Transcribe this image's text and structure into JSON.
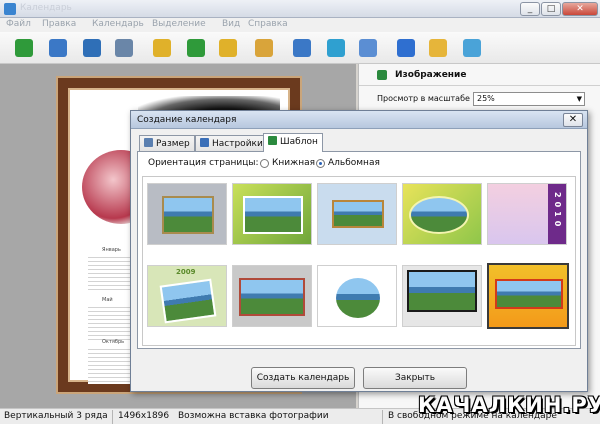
{
  "window": {
    "title": "Календарь",
    "controls": [
      "_",
      "□",
      "✕"
    ]
  },
  "menu": [
    "Файл",
    "Правка",
    "Календарь",
    "Выделение",
    "Вид",
    "Справка"
  ],
  "toolbar": [
    {
      "icon": "add-page-icon",
      "color": "#2f9a3a"
    },
    {
      "icon": "image-lbp-icon",
      "color": "#3b78c6"
    },
    {
      "icon": "save-icon",
      "color": "#2f6fb7"
    },
    {
      "icon": "print-icon",
      "color": "#6a86a8"
    },
    {
      "icon": "add-folder-icon",
      "color": "#e0b12a"
    },
    {
      "icon": "text-icon",
      "color": "#2f9a3a"
    },
    {
      "icon": "edit-text-icon",
      "color": "#e0b12a"
    },
    {
      "icon": "picture-icon",
      "color": "#d9a43a"
    },
    {
      "icon": "grid-icon",
      "color": "#3b78c6"
    },
    {
      "icon": "move-icon",
      "color": "#2fa0d0"
    },
    {
      "icon": "zoom-icon",
      "color": "#5b8ed3"
    },
    {
      "icon": "help-icon",
      "color": "#2f6fd0"
    },
    {
      "icon": "lock-icon",
      "color": "#e6b53a"
    },
    {
      "icon": "box-icon",
      "color": "#4aa3d8"
    }
  ],
  "panel": {
    "title": "Изображение",
    "zoom_label": "Просмотр в масштабе",
    "zoom_value": "25%"
  },
  "preview": {
    "months": [
      "Январь",
      "Май",
      "Октябрь"
    ]
  },
  "dialog": {
    "title": "Создание календаря",
    "close": "✕",
    "tabs": [
      "Размер",
      "Настройки",
      "Шаблон"
    ],
    "orientation_label": "Ориентация страницы:",
    "orientation_options": [
      "Книжная",
      "Альбомная"
    ],
    "orientation_selected": "Альбомная",
    "template_years": {
      "t5": "2010",
      "t6": "2009"
    },
    "create_button": "Создать календарь",
    "close_button": "Закрыть"
  },
  "statusbar": {
    "layout": "Вертикальный 3 ряда",
    "size": "1496x1896",
    "note": "Возможна вставка фотографии",
    "right": "В свободном режиме на календаре"
  },
  "watermark": "КАЧАЛКИН.РУ"
}
